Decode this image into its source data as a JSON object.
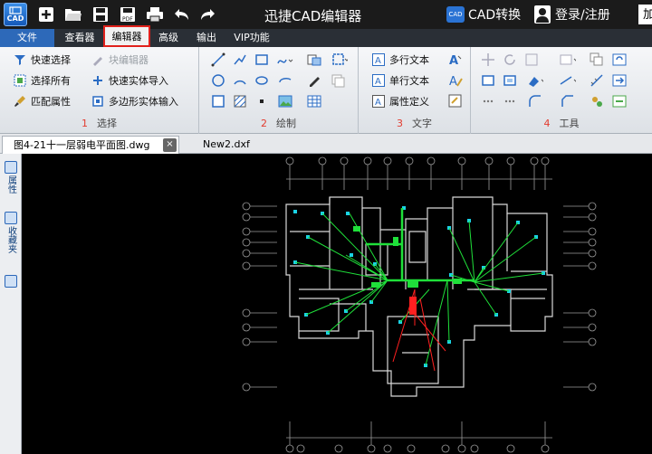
{
  "app": {
    "title": "迅捷CAD编辑器",
    "logo_text": "CAD",
    "cad_convert": "CAD转换",
    "login": "登录/注册",
    "more": "加"
  },
  "menu": {
    "file": "文件",
    "viewer": "查看器",
    "editor": "编辑器",
    "advanced": "高级",
    "output": "输出",
    "vip": "VIP功能"
  },
  "ribbon": {
    "select": {
      "num": "1",
      "label": "选择",
      "items": [
        "快速选择",
        "选择所有",
        "匹配属性",
        "块编辑器",
        "快速实体导入",
        "多边形实体输入"
      ]
    },
    "draw": {
      "num": "2",
      "label": "绘制"
    },
    "text": {
      "num": "3",
      "label": "文字",
      "items": [
        "多行文本",
        "单行文本",
        "属性定义"
      ]
    },
    "tools": {
      "num": "4",
      "label": "工具"
    }
  },
  "tabs": {
    "doc1": "图4-21十一层弱电平面图.dwg",
    "doc1_close": "×",
    "doc2": "New2.dxf"
  },
  "side": {
    "properties": "属性",
    "favorites": "收藏夹"
  },
  "colors": {
    "accent": "#2d69b9",
    "highlight": "#e0201b",
    "canvas": "#000000"
  }
}
